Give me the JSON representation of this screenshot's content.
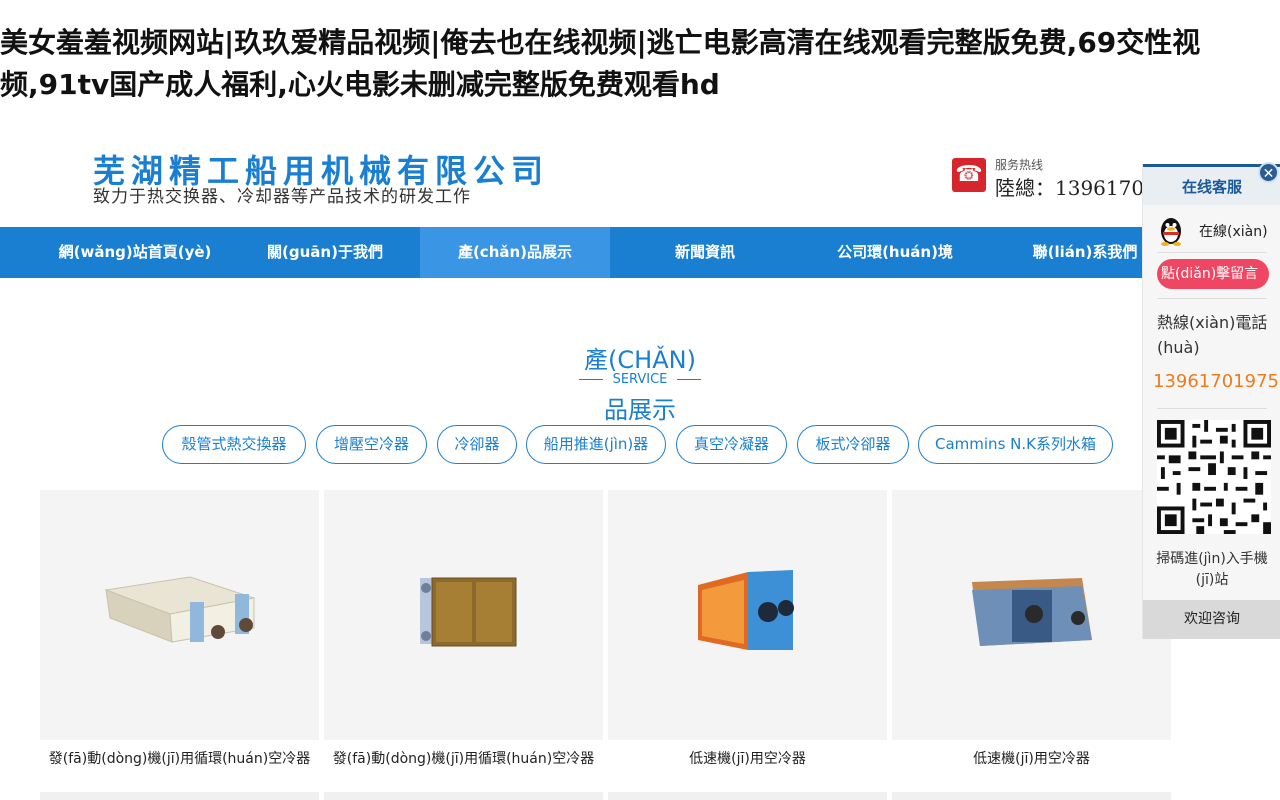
{
  "site_title": "美女羞羞视频网站|玖玖爱精品视频|俺去也在线视频|逃亡电影高清在线观看完整版免费,69交性视频,91tv国产成人福利,心火电影未删减完整版免费观看hd",
  "header": {
    "company_name": "芜湖精工船用机械有限公司",
    "tagline": "致力于热交换器、冷却器等产品技术的研发工作",
    "hotline_label": "服务热线",
    "hotline_number": "陸總：1396170"
  },
  "nav": {
    "items": [
      {
        "label": "網(wǎng)站首頁(yè)",
        "active": false
      },
      {
        "label": "關(guān)于我們",
        "active": false
      },
      {
        "label": "產(chǎn)品展示",
        "active": true
      },
      {
        "label": "新聞資訊",
        "active": false
      },
      {
        "label": "公司環(huán)境",
        "active": false
      },
      {
        "label": "聯(lián)系我們",
        "active": false
      }
    ]
  },
  "section": {
    "title_top": "產(CHǍN)",
    "subtitle": "SERVICE",
    "title_bottom": "品展示"
  },
  "categories": [
    "殼管式熱交換器",
    "增壓空冷器",
    "冷卻器",
    "船用推進(jìn)器",
    "真空冷凝器",
    "板式冷卻器",
    "Cammins N.K系列水箱"
  ],
  "products": [
    {
      "caption": "發(fā)動(dòng)機(jī)用循環(huán)空冷器",
      "image": "white-frame-heat-exchanger"
    },
    {
      "caption": "發(fā)動(dòng)機(jī)用循環(huán)空冷器",
      "image": "copper-fin-cooler"
    },
    {
      "caption": "低速機(jī)用空冷器",
      "image": "orange-core-cooler"
    },
    {
      "caption": "低速機(jī)用空冷器",
      "image": "blue-frame-cooler"
    }
  ],
  "kefu": {
    "header": "在线客服",
    "close_icon": "close-icon",
    "qq_label": "在線(xiàn)",
    "message_button": "點(diǎn)擊留言",
    "tel_label": "熱線(xiàn)電話(huà)",
    "tel_number": "13961701975",
    "qr_label": "掃碼進(jìn)入手機(jī)站",
    "footer": "欢迎咨询"
  },
  "colors": {
    "brand_blue": "#1a7fd0",
    "nav_active": "#3a95e4",
    "message_pink": "#ef4763",
    "tel_orange": "#ef7c1a",
    "phone_red": "#d6252c"
  }
}
